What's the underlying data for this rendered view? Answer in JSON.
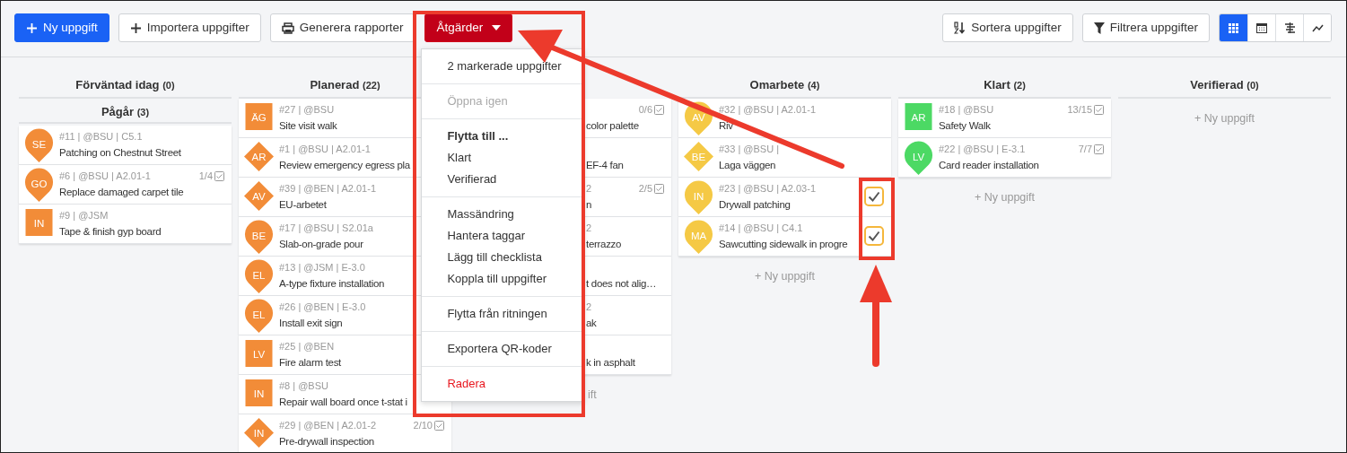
{
  "toolbar": {
    "left_buttons": [
      {
        "label": "Ny uppgift",
        "kind": "primary"
      },
      {
        "label": "Importera uppgifter",
        "kind": "outline"
      },
      {
        "label": "Generera rapporter",
        "kind": "outline"
      }
    ],
    "actions_button": {
      "label": "Åtgärder",
      "expanded": true
    },
    "right_buttons": [
      {
        "label": "Sortera uppgifter"
      },
      {
        "label": "Filtrera uppgifter"
      }
    ],
    "views": [
      {
        "selected": true
      },
      {
        "selected": false
      },
      {
        "selected": false
      },
      {
        "selected": false
      }
    ]
  },
  "actions_menu": {
    "sections": [
      [
        {
          "label": "2 markerade uppgifter",
          "kind": "info",
          "disabled": false
        }
      ],
      [
        {
          "label": "Öppna igen",
          "kind": "action",
          "disabled": true
        }
      ],
      [
        {
          "label": "Flytta till ...",
          "kind": "heading",
          "disabled": false
        },
        {
          "label": "Klart",
          "kind": "action",
          "disabled": false
        },
        {
          "label": "Verifierad",
          "kind": "action",
          "disabled": false
        }
      ],
      [
        {
          "label": "Massändring",
          "kind": "action",
          "disabled": false
        },
        {
          "label": "Hantera taggar",
          "kind": "action",
          "disabled": false
        },
        {
          "label": "Lägg till checklista",
          "kind": "action",
          "disabled": false
        },
        {
          "label": "Koppla till uppgifter",
          "kind": "action",
          "disabled": false
        }
      ],
      [
        {
          "label": "Flytta från ritningen",
          "kind": "action",
          "disabled": false
        }
      ],
      [
        {
          "label": "Exportera QR-koder",
          "kind": "action",
          "disabled": false
        }
      ],
      [
        {
          "label": "Radera",
          "kind": "danger",
          "disabled": false
        }
      ]
    ]
  },
  "columns": [
    {
      "groups": [
        {
          "title": "Förväntad idag",
          "count": "(0)"
        },
        {
          "title": "Pågår",
          "count": "(3)",
          "cards": [
            {
              "kind": "pin",
              "color": "#f28c38",
              "initials": "SE",
              "meta": "#11 | @BSU | C5.1",
              "title": "Patching on Chestnut Street",
              "selected": false
            },
            {
              "kind": "pin",
              "color": "#f28c38",
              "initials": "GO",
              "meta": "#6 | @BSU | A2.01-1",
              "progress": "1/4",
              "title": "Replace damaged carpet tile",
              "selected": false
            },
            {
              "kind": "square",
              "color": "#f28c38",
              "initials": "IN",
              "meta": "#9 | @JSM",
              "title": "Tape & finish gyp board",
              "selected": false
            }
          ]
        }
      ]
    },
    {
      "groups": [
        {
          "title": "Planerad",
          "count": "(22)",
          "cards": [
            {
              "kind": "square",
              "color": "#f28c38",
              "initials": "ÄG",
              "meta": "#27 | @BSU",
              "title": "Site visit walk",
              "selected": false
            },
            {
              "kind": "diamond",
              "color": "#f28c38",
              "initials": "AR",
              "meta": "#1 | @BSU | A2.01-1",
              "title": "Review emergency egress pla",
              "selected": false
            },
            {
              "kind": "diamond",
              "color": "#f28c38",
              "initials": "AV",
              "meta": "#39 | @BEN | A2.01-1",
              "title": "EU-arbetet",
              "selected": false
            },
            {
              "kind": "pin",
              "color": "#f28c38",
              "initials": "BE",
              "meta": "#17 | @BSU | S2.01a",
              "title": "Slab-on-grade pour",
              "selected": false
            },
            {
              "kind": "pin",
              "color": "#f28c38",
              "initials": "EL",
              "meta": "#13 | @JSM | E-3.0",
              "title": "A-type fixture installation",
              "selected": false
            },
            {
              "kind": "pin",
              "color": "#f28c38",
              "initials": "EL",
              "meta": "#26 | @BEN | E-3.0",
              "title": "Install exit sign",
              "selected": false
            },
            {
              "kind": "square",
              "color": "#f28c38",
              "initials": "LV",
              "meta": "#25 | @BEN",
              "title": "Fire alarm test",
              "selected": false
            },
            {
              "kind": "square",
              "color": "#f28c38",
              "initials": "IN",
              "meta": "#8 | @BSU",
              "title": "Repair wall board once t-stat i",
              "selected": false
            },
            {
              "kind": "diamond",
              "color": "#f28c38",
              "initials": "IN",
              "meta": "#29 | @BEN | A2.01-2",
              "progress": "2/10",
              "title": "Pre-drywall inspection",
              "selected": false
            }
          ]
        }
      ]
    },
    {
      "groups": [
        {
          "cards": [
            {
              "progress": "0/6",
              "title": "color palette",
              "selected": false
            },
            {
              "title": "EF-4 fan",
              "selected": false
            },
            {
              "meta": "2",
              "progress": "2/5",
              "title": "n",
              "selected": false
            },
            {
              "meta": "2",
              "title": "terrazzo",
              "selected": false
            },
            {
              "title": "t does not alig…",
              "selected": false
            },
            {
              "meta": "2",
              "title": "ak",
              "selected": false
            },
            {
              "title": "k in asphalt",
              "selected": false
            }
          ],
          "add_label": "ift"
        }
      ]
    },
    {
      "groups": [
        {
          "title": "Omarbete",
          "count": "(4)",
          "cards": [
            {
              "kind": "pin",
              "color": "#f5c945",
              "initials": "AV",
              "meta": "#32 | @BSU | A2.01-1",
              "title": "Riv",
              "selected": false
            },
            {
              "kind": "diamond",
              "color": "#f5c945",
              "initials": "BE",
              "meta": "#33 | @BSU |",
              "title": "Laga väggen",
              "selected": false
            },
            {
              "kind": "pin",
              "color": "#f5c945",
              "initials": "IN",
              "meta": "#23 | @BSU | A2.03-1",
              "title": "Drywall patching",
              "selected": true
            },
            {
              "kind": "pin",
              "color": "#f5c945",
              "initials": "MA",
              "meta": "#14 | @BSU | C4.1",
              "title": "Sawcutting sidewalk in progre",
              "selected": true
            }
          ],
          "add_label": "+ Ny uppgift"
        }
      ]
    },
    {
      "groups": [
        {
          "title": "Klart",
          "count": "(2)",
          "cards": [
            {
              "kind": "square",
              "color": "#4cd964",
              "initials": "AR",
              "meta": "#18 | @BSU",
              "progress": "13/15",
              "title": "Safety Walk",
              "selected": false
            },
            {
              "kind": "pin",
              "color": "#4cd964",
              "initials": "LV",
              "meta": "#22 | @BSU | E-3.1",
              "progress": "7/7",
              "title": "Card reader installation",
              "selected": false
            }
          ],
          "add_label": "+ Ny uppgift"
        }
      ]
    },
    {
      "groups": [
        {
          "title": "Verifierad",
          "count": "(0)",
          "add_label": "+ Ny uppgift"
        }
      ]
    }
  ]
}
